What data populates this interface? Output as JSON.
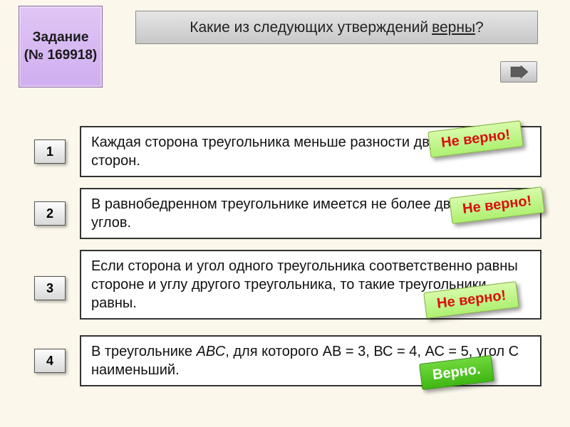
{
  "task": {
    "label": "Задание",
    "number": "(№ 169918)"
  },
  "question": {
    "prefix": "Какие из следующих утверждений ",
    "emph": "верны",
    "suffix": "?"
  },
  "nav": {
    "next_icon": "next-arrow-icon"
  },
  "numbers": [
    "1",
    "2",
    "3",
    "4"
  ],
  "statements": {
    "s1": "Каждая сторона треугольника меньше разности двух других сторон.",
    "s2": "В равнобедренном треугольнике имеется не более двух равных углов.",
    "s3": "Если сторона и угол одного треугольника соответственно равны стороне и углу другого треугольника, то такие треугольники равны.",
    "s4_pre": "В треугольнике ",
    "s4_it": "АВС",
    "s4_post": ", для которого АВ = 3, ВС = 4, АС = 5, угол С наименьший."
  },
  "results": {
    "wrong": "Не верно!",
    "right": "Верно."
  }
}
